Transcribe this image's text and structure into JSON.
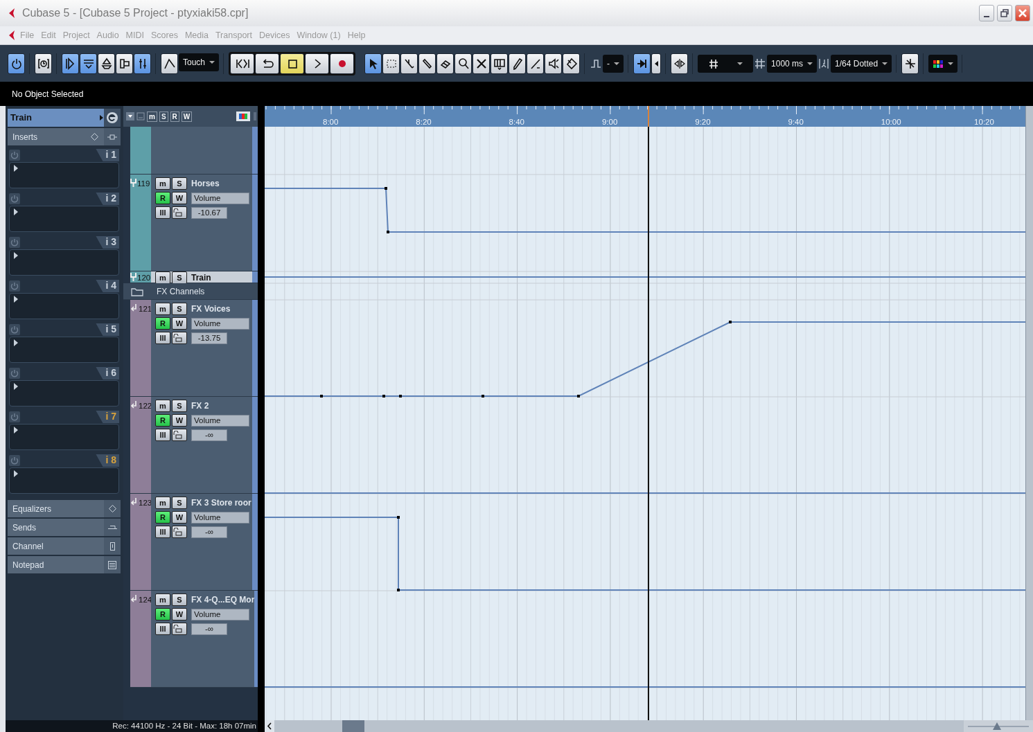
{
  "window": {
    "title": "Cubase 5 - [Cubase 5 Project - ptyxiaki58.cpr]"
  },
  "menu": [
    "File",
    "Edit",
    "Project",
    "Audio",
    "MIDI",
    "Scores",
    "Media",
    "Transport",
    "Devices",
    "Window (1)",
    "Help"
  ],
  "toolbar": {
    "groups": [
      {
        "kind": "plain",
        "items": [
          {
            "kind": "button",
            "selected": true
          }
        ]
      },
      {
        "kind": "plain",
        "items": [
          {
            "kind": "button",
            "selected": false
          }
        ]
      },
      {
        "kind": "plain",
        "items": [
          {
            "kind": "button",
            "selected": true
          },
          {
            "kind": "button",
            "selected": true
          },
          {
            "kind": "button",
            "selected": false
          },
          {
            "kind": "button",
            "selected": false
          },
          {
            "kind": "button",
            "selected": true
          }
        ]
      },
      {
        "kind": "plain",
        "items": [
          {
            "kind": "button",
            "selected": false
          },
          {
            "kind": "dropdown",
            "value": "Touch"
          }
        ]
      },
      {
        "kind": "transport",
        "items": [
          {
            "kind": "button",
            "selected": false
          },
          {
            "kind": "button",
            "selected": false
          },
          {
            "kind": "button",
            "selected": true
          },
          {
            "kind": "button",
            "selected": false
          },
          {
            "kind": "button",
            "selected": false
          }
        ]
      },
      {
        "kind": "plain",
        "items": [
          {
            "kind": "button",
            "selected": true
          },
          {
            "kind": "button",
            "selected": false
          },
          {
            "kind": "button",
            "selected": false
          },
          {
            "kind": "button",
            "selected": false
          },
          {
            "kind": "button",
            "selected": false
          },
          {
            "kind": "button",
            "selected": false
          },
          {
            "kind": "button",
            "selected": false
          },
          {
            "kind": "button",
            "selected": false
          },
          {
            "kind": "button",
            "selected": false
          },
          {
            "kind": "button",
            "selected": false
          },
          {
            "kind": "button",
            "selected": false
          },
          {
            "kind": "button",
            "selected": false
          }
        ]
      },
      {
        "kind": "plain",
        "items": [
          {
            "kind": "icon"
          },
          {
            "kind": "dropdown",
            "value": "-"
          }
        ]
      },
      {
        "kind": "plain",
        "items": [
          {
            "kind": "button",
            "selected": true
          },
          {
            "kind": "button",
            "selected": false
          }
        ]
      },
      {
        "kind": "plain",
        "items": [
          {
            "kind": "button",
            "selected": false
          }
        ]
      },
      {
        "kind": "plain",
        "items": [
          {
            "kind": "icon_dropdown"
          },
          {
            "kind": "icon"
          },
          {
            "kind": "dropdown",
            "value": "1000 ms"
          },
          {
            "kind": "icon"
          },
          {
            "kind": "dropdown",
            "value": "1/64 Dotted"
          }
        ]
      },
      {
        "kind": "plain",
        "items": [
          {
            "kind": "button",
            "selected": false
          }
        ]
      },
      {
        "kind": "plain",
        "items": [
          {
            "kind": "color_dropdown"
          }
        ]
      }
    ]
  },
  "info_line": "No Object Selected",
  "inspector": {
    "track_name": "Train",
    "section": "Inserts",
    "slots": [
      {
        "label": "i 1",
        "color": "#c9d2dc"
      },
      {
        "label": "i 2",
        "color": "#c9d2dc"
      },
      {
        "label": "i 3",
        "color": "#c9d2dc"
      },
      {
        "label": "i 4",
        "color": "#c9d2dc"
      },
      {
        "label": "i 5",
        "color": "#c9d2dc"
      },
      {
        "label": "i 6",
        "color": "#c9d2dc"
      },
      {
        "label": "i 7",
        "color": "#d9a33c"
      },
      {
        "label": "i 8",
        "color": "#d9a33c"
      }
    ],
    "sections": [
      "Equalizers",
      "Sends",
      "Channel",
      "Notepad"
    ]
  },
  "track_list_header": {
    "buttons": [
      "m",
      "S",
      "R",
      "W"
    ]
  },
  "tracks": [
    {
      "kind": "automation",
      "channel": {
        "kind": "group"
      },
      "number": "119",
      "name": "Horses",
      "color": "#5e9fa8",
      "parameter": "Volume",
      "value": "-10.67",
      "controls": [
        {
          "label": "m",
          "on": false
        },
        {
          "label": "S",
          "on": false
        },
        {
          "label": "R",
          "on": true
        },
        {
          "label": "W",
          "on": false
        },
        {
          "label": "III",
          "on": false
        }
      ]
    },
    {
      "kind": "collapsed",
      "channel": {
        "kind": "group"
      },
      "number": "120",
      "name": "Train",
      "color": "#5e9fa8",
      "controls": [
        {
          "label": "m",
          "on": false
        },
        {
          "label": "S",
          "on": false
        }
      ]
    },
    {
      "kind": "folder",
      "name": "FX Channels"
    },
    {
      "kind": "automation",
      "channel": {
        "kind": "fx"
      },
      "number": "121",
      "name": "FX Voices",
      "color": "#8e7e98",
      "parameter": "Volume",
      "value": "-13.75",
      "controls": [
        {
          "label": "m",
          "on": false
        },
        {
          "label": "S",
          "on": false
        },
        {
          "label": "R",
          "on": true
        },
        {
          "label": "W",
          "on": false
        },
        {
          "label": "III",
          "on": false
        }
      ]
    },
    {
      "kind": "automation",
      "channel": {
        "kind": "fx"
      },
      "number": "122",
      "name": "FX 2",
      "color": "#8e7e98",
      "parameter": "Volume",
      "value": "-∞",
      "controls": [
        {
          "label": "m",
          "on": false
        },
        {
          "label": "S",
          "on": false
        },
        {
          "label": "R",
          "on": true
        },
        {
          "label": "W",
          "on": false
        },
        {
          "label": "III",
          "on": false
        }
      ]
    },
    {
      "kind": "automation",
      "channel": {
        "kind": "fx"
      },
      "number": "123",
      "name": "FX 3 Store roor",
      "color": "#8e7e98",
      "parameter": "Volume",
      "value": "-∞",
      "controls": [
        {
          "label": "m",
          "on": false
        },
        {
          "label": "S",
          "on": false
        },
        {
          "label": "R",
          "on": true
        },
        {
          "label": "W",
          "on": false
        },
        {
          "label": "III",
          "on": false
        }
      ]
    },
    {
      "kind": "automation",
      "channel": {
        "kind": "fx"
      },
      "number": "124",
      "name": "FX 4-Q...EQ Mor",
      "color": "#8e7e98",
      "parameter": "Volume",
      "value": "-∞",
      "controls": [
        {
          "label": "m",
          "on": false
        },
        {
          "label": "S",
          "on": false
        },
        {
          "label": "R",
          "on": true
        },
        {
          "label": "W",
          "on": false
        },
        {
          "label": "III",
          "on": false
        }
      ]
    }
  ],
  "ruler": {
    "labels": [
      "8:00",
      "8:20",
      "8:40",
      "9:00",
      "9:20",
      "9:40",
      "10:00",
      "10:20"
    ]
  },
  "status_bar": "Rec: 44100 Hz - 24 Bit - Max: 18h 07min"
}
